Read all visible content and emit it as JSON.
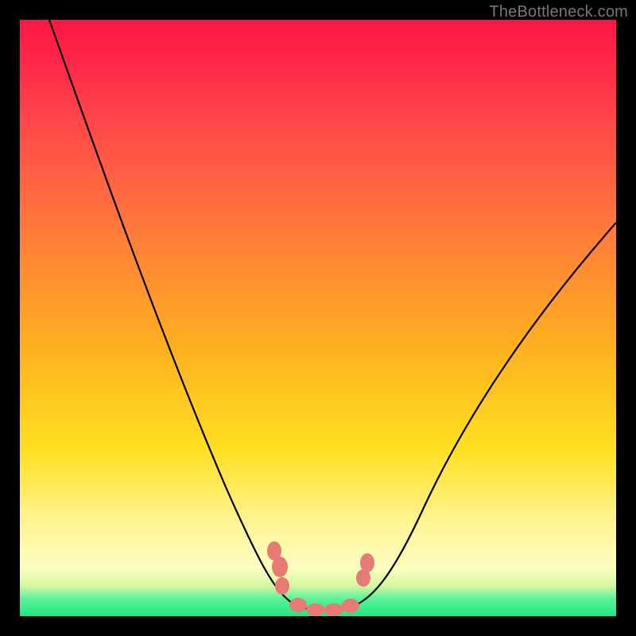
{
  "watermark": "TheBottleneck.com",
  "chart_data": {
    "type": "line",
    "title": "",
    "xlabel": "",
    "ylabel": "",
    "xlim": [
      0,
      100
    ],
    "ylim": [
      0,
      100
    ],
    "series": [
      {
        "name": "curve",
        "x": [
          5,
          10,
          15,
          20,
          25,
          30,
          35,
          40,
          43,
          46,
          48,
          50,
          52,
          54,
          56,
          58,
          60,
          65,
          70,
          75,
          80,
          85,
          90,
          95,
          100
        ],
        "y": [
          100,
          90,
          80,
          70,
          60,
          49,
          38,
          26,
          18,
          10,
          5,
          2,
          1,
          1,
          2,
          5,
          10,
          22,
          33,
          42,
          50,
          56,
          61,
          65,
          68
        ]
      }
    ],
    "markers": {
      "name": "highlight-dots",
      "color": "#e77a74",
      "x": [
        43.5,
        44.5,
        47,
        50,
        53,
        55.5,
        57,
        58
      ],
      "y": [
        12,
        10,
        2.5,
        1.5,
        1.8,
        3.5,
        10,
        12
      ]
    },
    "gradient_stops": [
      {
        "pos": 0,
        "color": "#ff1744"
      },
      {
        "pos": 35,
        "color": "#ff7a3a"
      },
      {
        "pos": 72,
        "color": "#ffe020"
      },
      {
        "pos": 92,
        "color": "#fdfdc0"
      },
      {
        "pos": 100,
        "color": "#1de885"
      }
    ]
  }
}
